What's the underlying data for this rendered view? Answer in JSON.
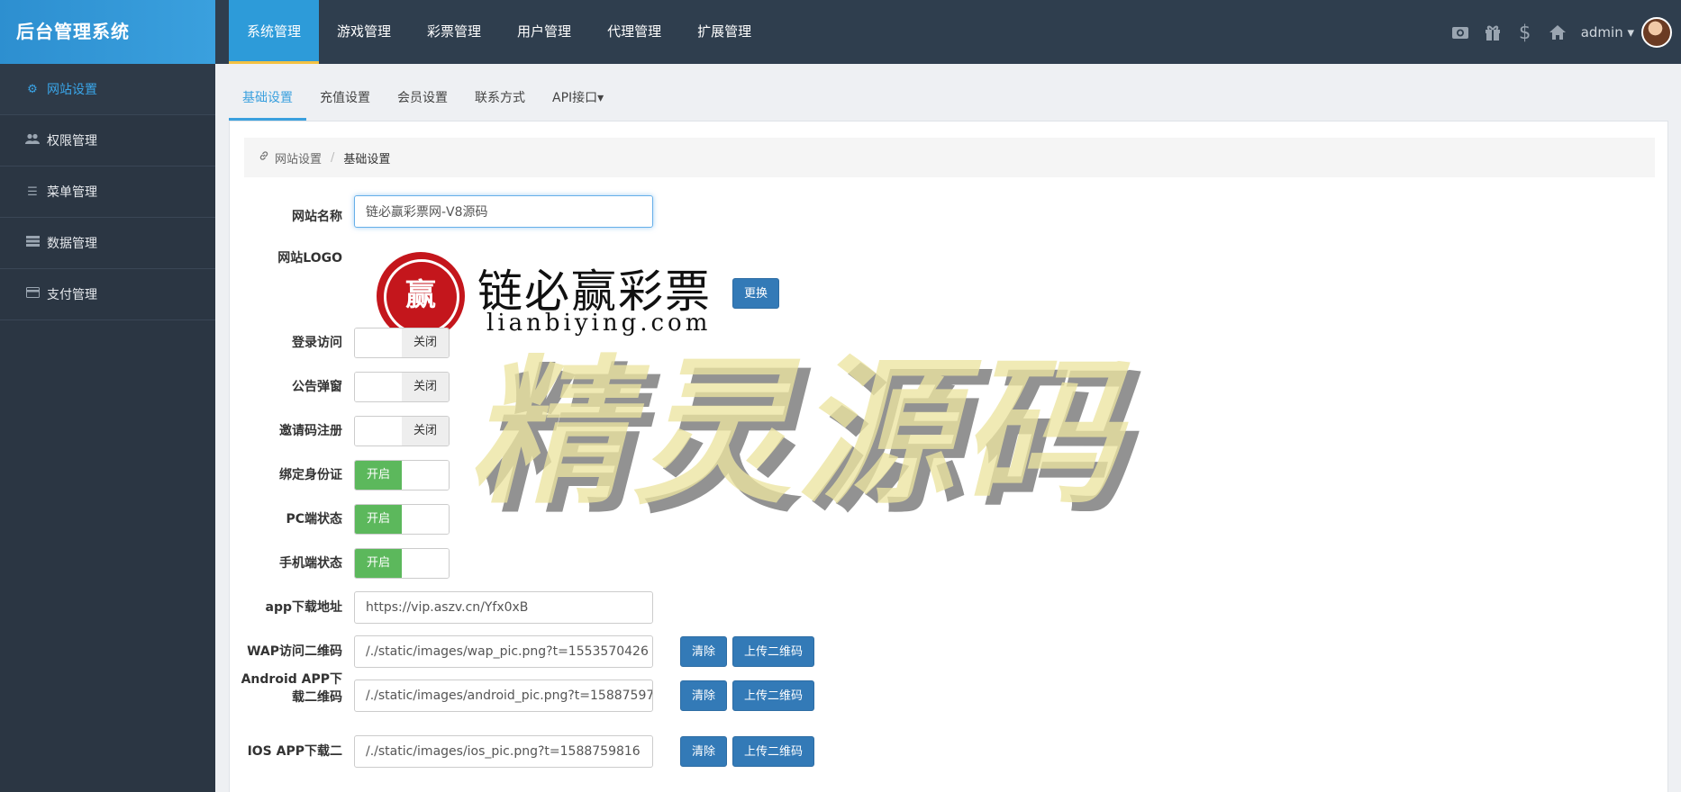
{
  "brand": "后台管理系统",
  "top_nav": [
    {
      "label": "系统管理",
      "active": true
    },
    {
      "label": "游戏管理",
      "active": false
    },
    {
      "label": "彩票管理",
      "active": false
    },
    {
      "label": "用户管理",
      "active": false
    },
    {
      "label": "代理管理",
      "active": false
    },
    {
      "label": "扩展管理",
      "active": false
    }
  ],
  "top_right": {
    "icons": [
      "camera-icon",
      "gift-icon",
      "dollar-icon",
      "home-icon"
    ],
    "user": "admin ▾"
  },
  "sidebar": [
    {
      "label": "网站设置",
      "icon": "gear-icon",
      "active": true
    },
    {
      "label": "权限管理",
      "icon": "users-icon",
      "active": false
    },
    {
      "label": "菜单管理",
      "icon": "list-icon",
      "active": false
    },
    {
      "label": "数据管理",
      "icon": "database-icon",
      "active": false
    },
    {
      "label": "支付管理",
      "icon": "credit-card-icon",
      "active": false
    }
  ],
  "tabs": [
    {
      "label": "基础设置",
      "active": true
    },
    {
      "label": "充值设置",
      "active": false
    },
    {
      "label": "会员设置",
      "active": false
    },
    {
      "label": "联系方式",
      "active": false
    },
    {
      "label": "API接口▾",
      "active": false
    }
  ],
  "breadcrumb": {
    "parent": "网站设置",
    "sep": "/",
    "current": "基础设置"
  },
  "form": {
    "site_name_label": "网站名称",
    "site_name_value": "链必赢彩票网-V8源码",
    "logo_label": "网站LOGO",
    "logo_seal_char": "赢",
    "logo_cn": "链必赢彩票",
    "logo_en": "lianbiying.com",
    "replace_btn": "更换",
    "switches": [
      {
        "label": "登录访问",
        "state": "关闭",
        "on": false
      },
      {
        "label": "公告弹窗",
        "state": "关闭",
        "on": false
      },
      {
        "label": "邀请码注册",
        "state": "关闭",
        "on": false
      },
      {
        "label": "绑定身份证",
        "state": "开启",
        "on": true
      },
      {
        "label": "PC端状态",
        "state": "开启",
        "on": true
      },
      {
        "label": "手机端状态",
        "state": "开启",
        "on": true
      }
    ],
    "app_url_label": "app下载地址",
    "app_url_value": "https://vip.aszv.cn/Yfx0xB",
    "wap_label": "WAP访问二维码",
    "wap_value": "/./static/images/wap_pic.png?t=1553570426",
    "android_label_1": "Android APP下",
    "android_label_2": "载二维码",
    "android_value": "/./static/images/android_pic.png?t=15887597",
    "ios_label": "IOS APP下载二",
    "ios_value": "/./static/images/ios_pic.png?t=1588759816",
    "clear_btn": "清除",
    "upload_btn": "上传二维码"
  },
  "watermark": "精灵源码",
  "colors": {
    "accent": "#3aa0de",
    "topbar": "#2f3e4e",
    "sidebar": "#2b3643",
    "on": "#5cb85c",
    "btn": "#337ab7"
  }
}
